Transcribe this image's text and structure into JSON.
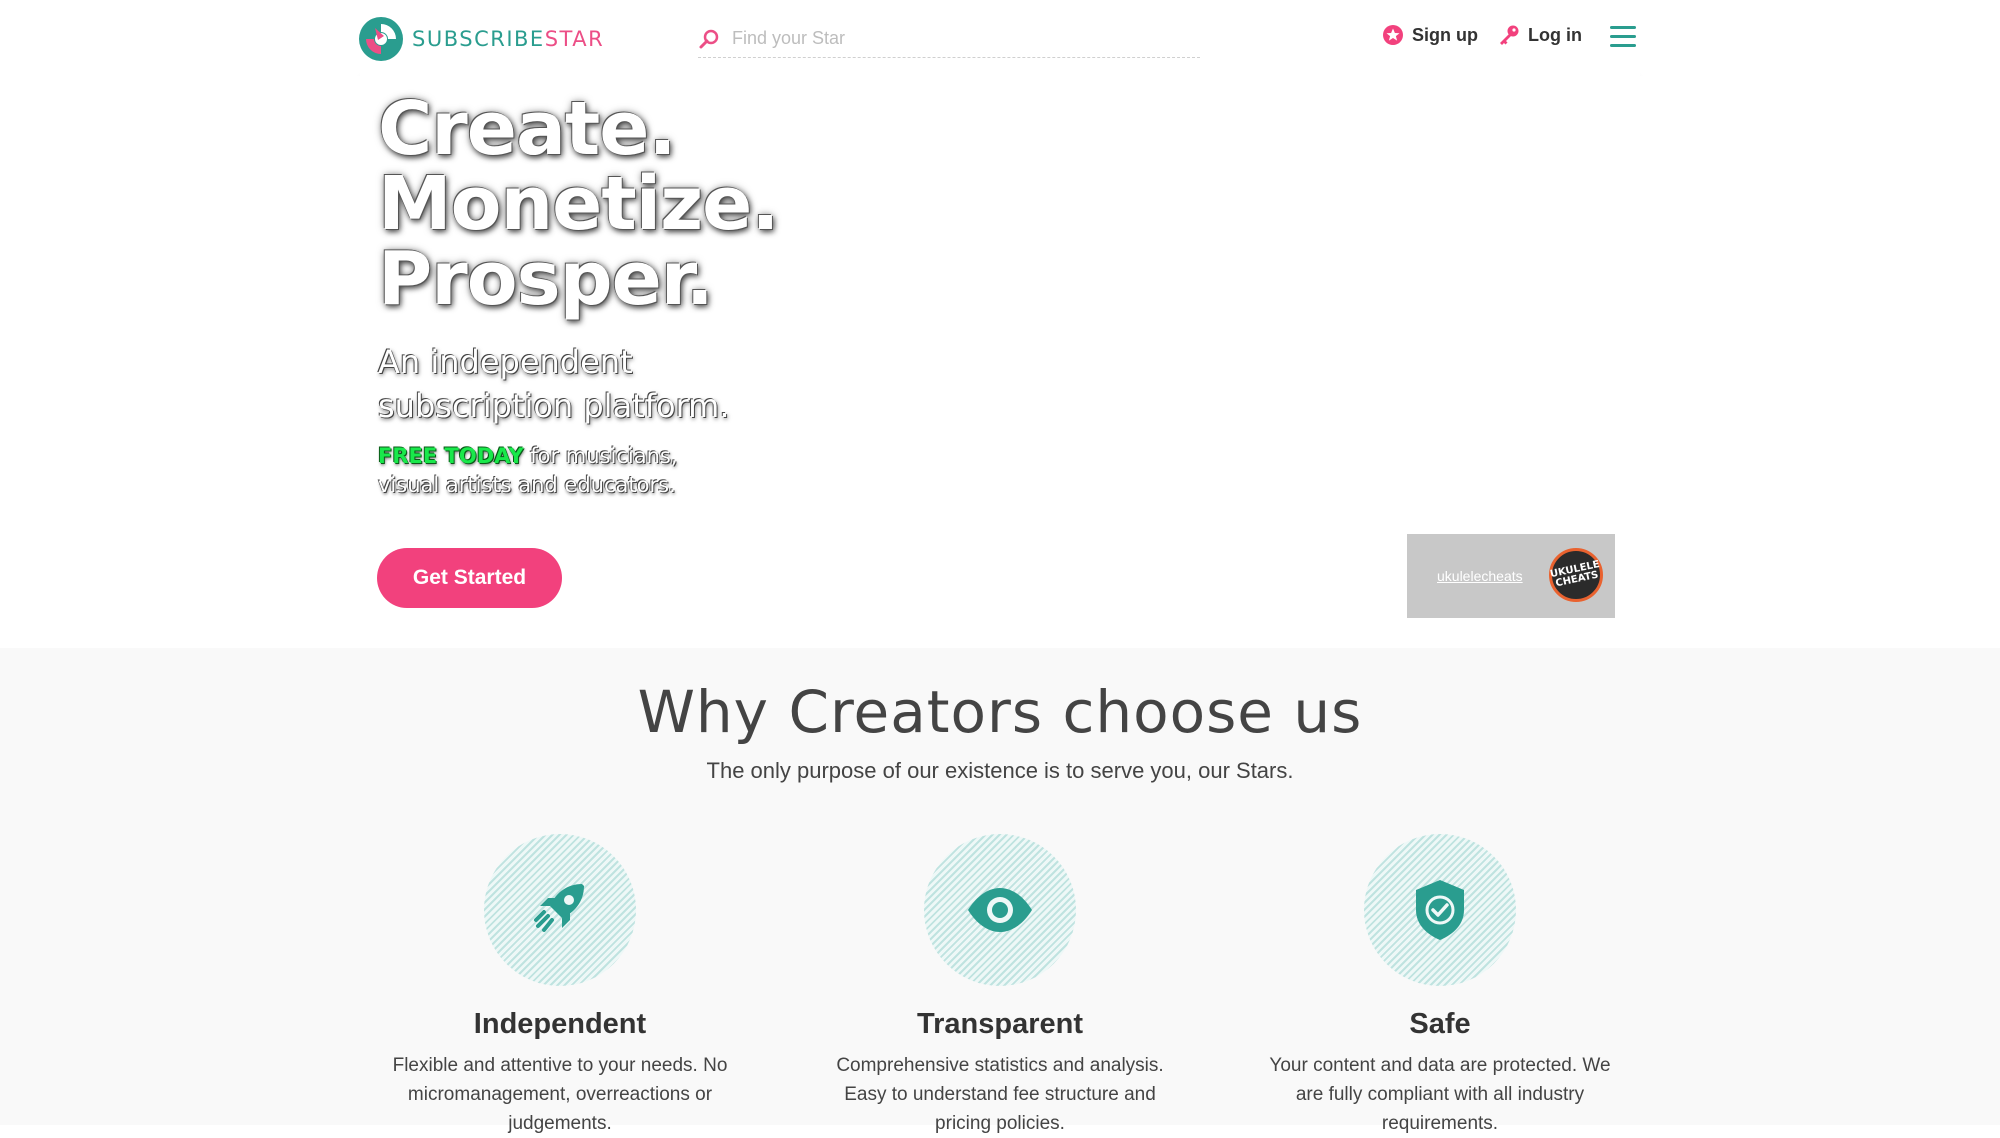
{
  "header": {
    "logo": {
      "text_a": "SUBSCRIBE",
      "text_b": "STAR"
    },
    "search": {
      "placeholder": "Find your Star"
    },
    "signup_label": "Sign up",
    "login_label": "Log in"
  },
  "hero": {
    "title_lines": [
      "Create.",
      "Monetize.",
      "Prosper."
    ],
    "subtitle": "An independent subscription platform.",
    "free_highlight": "FREE TODAY",
    "free_rest": " for musicians, visual artists and educators.",
    "cta_label": "Get Started",
    "creator": {
      "name": "ukulelecheats",
      "avatar_text": "UKULELE CHEATS"
    }
  },
  "why": {
    "title": "Why Creators choose us",
    "subtitle": "The only purpose of our existence is to serve you, our Stars.",
    "features": [
      {
        "icon": "rocket-icon",
        "title": "Independent",
        "text": "Flexible and attentive to your needs. No micromanagement, overreactions or judgements."
      },
      {
        "icon": "eye-icon",
        "title": "Transparent",
        "text": "Comprehensive statistics and analysis. Easy to understand fee structure and pricing policies."
      },
      {
        "icon": "shield-check-icon",
        "title": "Safe",
        "text": "Your content and data are protected. We are fully compliant with all industry requirements."
      }
    ]
  },
  "colors": {
    "brand_teal": "#2a9d8f",
    "brand_pink": "#f2417d",
    "highlight_green": "#19e84b"
  }
}
